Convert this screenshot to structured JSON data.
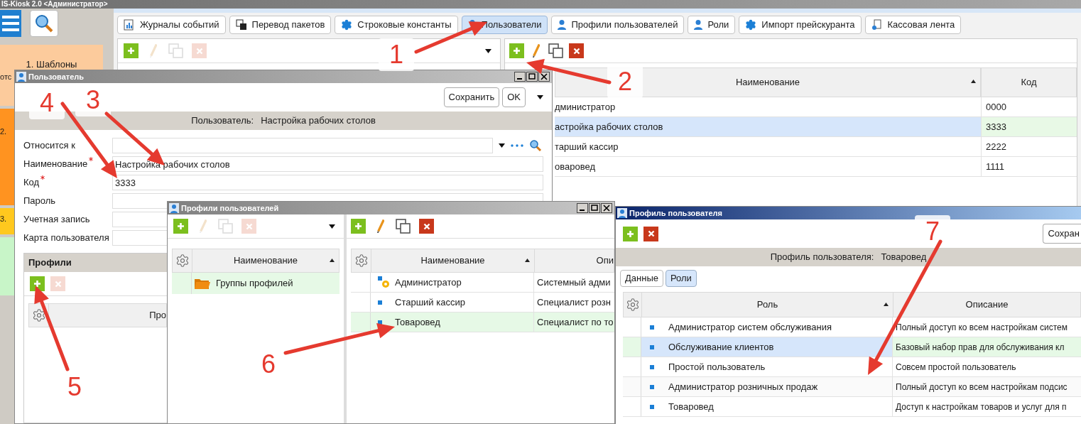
{
  "app_title": "IS-Kiosk 2.0 <Администратор>",
  "sidebar": {
    "tiles": [
      {
        "color": "#fccb9c",
        "texts": [
          "1. Шаблоны",
          "отс"
        ]
      },
      {
        "color": "#ff9320",
        "texts": [
          "2."
        ]
      },
      {
        "color": "#ffc81e",
        "texts": [
          "3."
        ]
      },
      {
        "color": "#c8f5c8"
      }
    ]
  },
  "tabs": [
    {
      "label": "Журналы событий",
      "selected": false
    },
    {
      "label": "Перевод пакетов",
      "selected": false
    },
    {
      "label": "Строковые константы",
      "selected": false
    },
    {
      "label": "Пользователи",
      "selected": true
    },
    {
      "label": "Профили пользователей",
      "selected": false
    },
    {
      "label": "Роли",
      "selected": false
    },
    {
      "label": "Импорт прейскуранта",
      "selected": false
    },
    {
      "label": "Кассовая лента",
      "selected": false
    }
  ],
  "left_toolbar": [
    {
      "kind": "add",
      "disabled": false
    },
    {
      "kind": "edit",
      "disabled": true
    },
    {
      "kind": "copy",
      "disabled": true
    },
    {
      "kind": "delete",
      "disabled": true
    }
  ],
  "right_toolbar": [
    {
      "kind": "add",
      "disabled": false
    },
    {
      "kind": "edit",
      "disabled": false
    },
    {
      "kind": "copy",
      "disabled": false
    },
    {
      "kind": "delete",
      "disabled": false
    }
  ],
  "users_table": {
    "columns": [
      {
        "label": "Наименование",
        "sorted": true
      },
      {
        "label": "Код",
        "sorted": false
      }
    ],
    "rows": [
      {
        "cells": [
          "дминистратор",
          "0000"
        ],
        "selected": false
      },
      {
        "cells": [
          "астройка рабочих столов",
          "3333"
        ],
        "selected": true
      },
      {
        "cells": [
          "тарший кассир",
          "2222"
        ],
        "selected": false
      },
      {
        "cells": [
          "оваровед",
          "1111"
        ],
        "selected": false
      }
    ]
  },
  "user_dialog": {
    "title": "Пользователь",
    "buttons": [
      "Сохранить",
      "OK"
    ],
    "header": {
      "caption": "Пользователь:",
      "value": "Настройка рабочих столов"
    },
    "fields": [
      {
        "label": "Относится к",
        "kind": "lookup",
        "required": false
      },
      {
        "label": "Наименование",
        "kind": "text",
        "required": true,
        "value": "Настройка рабочих столов"
      },
      {
        "label": "Код",
        "kind": "text",
        "required": true,
        "value": "3333"
      },
      {
        "label": "Пароль",
        "kind": "text",
        "required": false
      },
      {
        "label": "Учетная запись",
        "kind": "text",
        "required": false
      },
      {
        "label": "Карта пользователя",
        "kind": "text",
        "required": false
      }
    ],
    "profiles": {
      "title": "Профили",
      "toolbar": [
        {
          "kind": "add",
          "disabled": false
        },
        {
          "kind": "delete",
          "disabled": true
        }
      ],
      "column": "Про"
    }
  },
  "profiles_dialog": {
    "title": "Профили пользователей",
    "groups": {
      "toolbar": [
        {
          "kind": "add",
          "disabled": false
        },
        {
          "kind": "edit",
          "disabled": true
        },
        {
          "kind": "copy",
          "disabled": true
        },
        {
          "kind": "delete",
          "disabled": true
        }
      ],
      "column": {
        "label": "Наименование",
        "sorted": true
      },
      "rows": [
        {
          "name": "Группы профилей",
          "selected": true
        }
      ]
    },
    "list": {
      "toolbar": [
        {
          "kind": "add",
          "disabled": false
        },
        {
          "kind": "edit",
          "disabled": false
        },
        {
          "kind": "copy",
          "disabled": false
        },
        {
          "kind": "delete",
          "disabled": false
        }
      ],
      "columns": [
        {
          "label": "Наименование",
          "sorted": true
        },
        {
          "label": "Опи",
          "sorted": false
        }
      ],
      "rows": [
        {
          "kind": "admin",
          "name": "Администратор",
          "description": "Системный адми",
          "selected": false
        },
        {
          "kind": "profile",
          "name": "Старший кассир",
          "description": "Специалист розн",
          "selected": false
        },
        {
          "kind": "profile",
          "name": "Товаровед",
          "description": "Специалист по то",
          "selected": true
        }
      ]
    }
  },
  "profile_dialog": {
    "title": "Профиль пользователя",
    "toolbar": [
      {
        "kind": "add",
        "disabled": false
      },
      {
        "kind": "delete",
        "disabled": false
      }
    ],
    "save_button": "Сохран",
    "header": {
      "caption": "Профиль пользователя:",
      "value": "Товаровед"
    },
    "tabs": [
      {
        "label": "Данные",
        "selected": false
      },
      {
        "label": "Роли",
        "selected": true
      }
    ],
    "columns": [
      {
        "label": "Роль",
        "sorted": true
      },
      {
        "label": "Описание",
        "sorted": false
      }
    ],
    "rows": [
      {
        "role": "Администратор систем обслуживания",
        "description": "Полный доступ ко всем настройкам систем",
        "selected": false
      },
      {
        "role": "Обслуживание клиентов",
        "description": "Базовый набор прав для обслуживания кл",
        "selected": true
      },
      {
        "role": "Простой пользователь",
        "description": "Совсем простой пользователь",
        "selected": false
      },
      {
        "role": "Администратор розничных продаж",
        "description": "Полный доступ ко всем настройкам подсис",
        "selected": false
      },
      {
        "role": "Товаровед",
        "description": "Доступ к настройкам товаров и услуг для п",
        "selected": false
      }
    ]
  },
  "annotations": [
    {
      "label": "1"
    },
    {
      "label": "2"
    },
    {
      "label": "3"
    },
    {
      "label": "4"
    },
    {
      "label": "5"
    },
    {
      "label": "6"
    },
    {
      "label": "7"
    }
  ]
}
